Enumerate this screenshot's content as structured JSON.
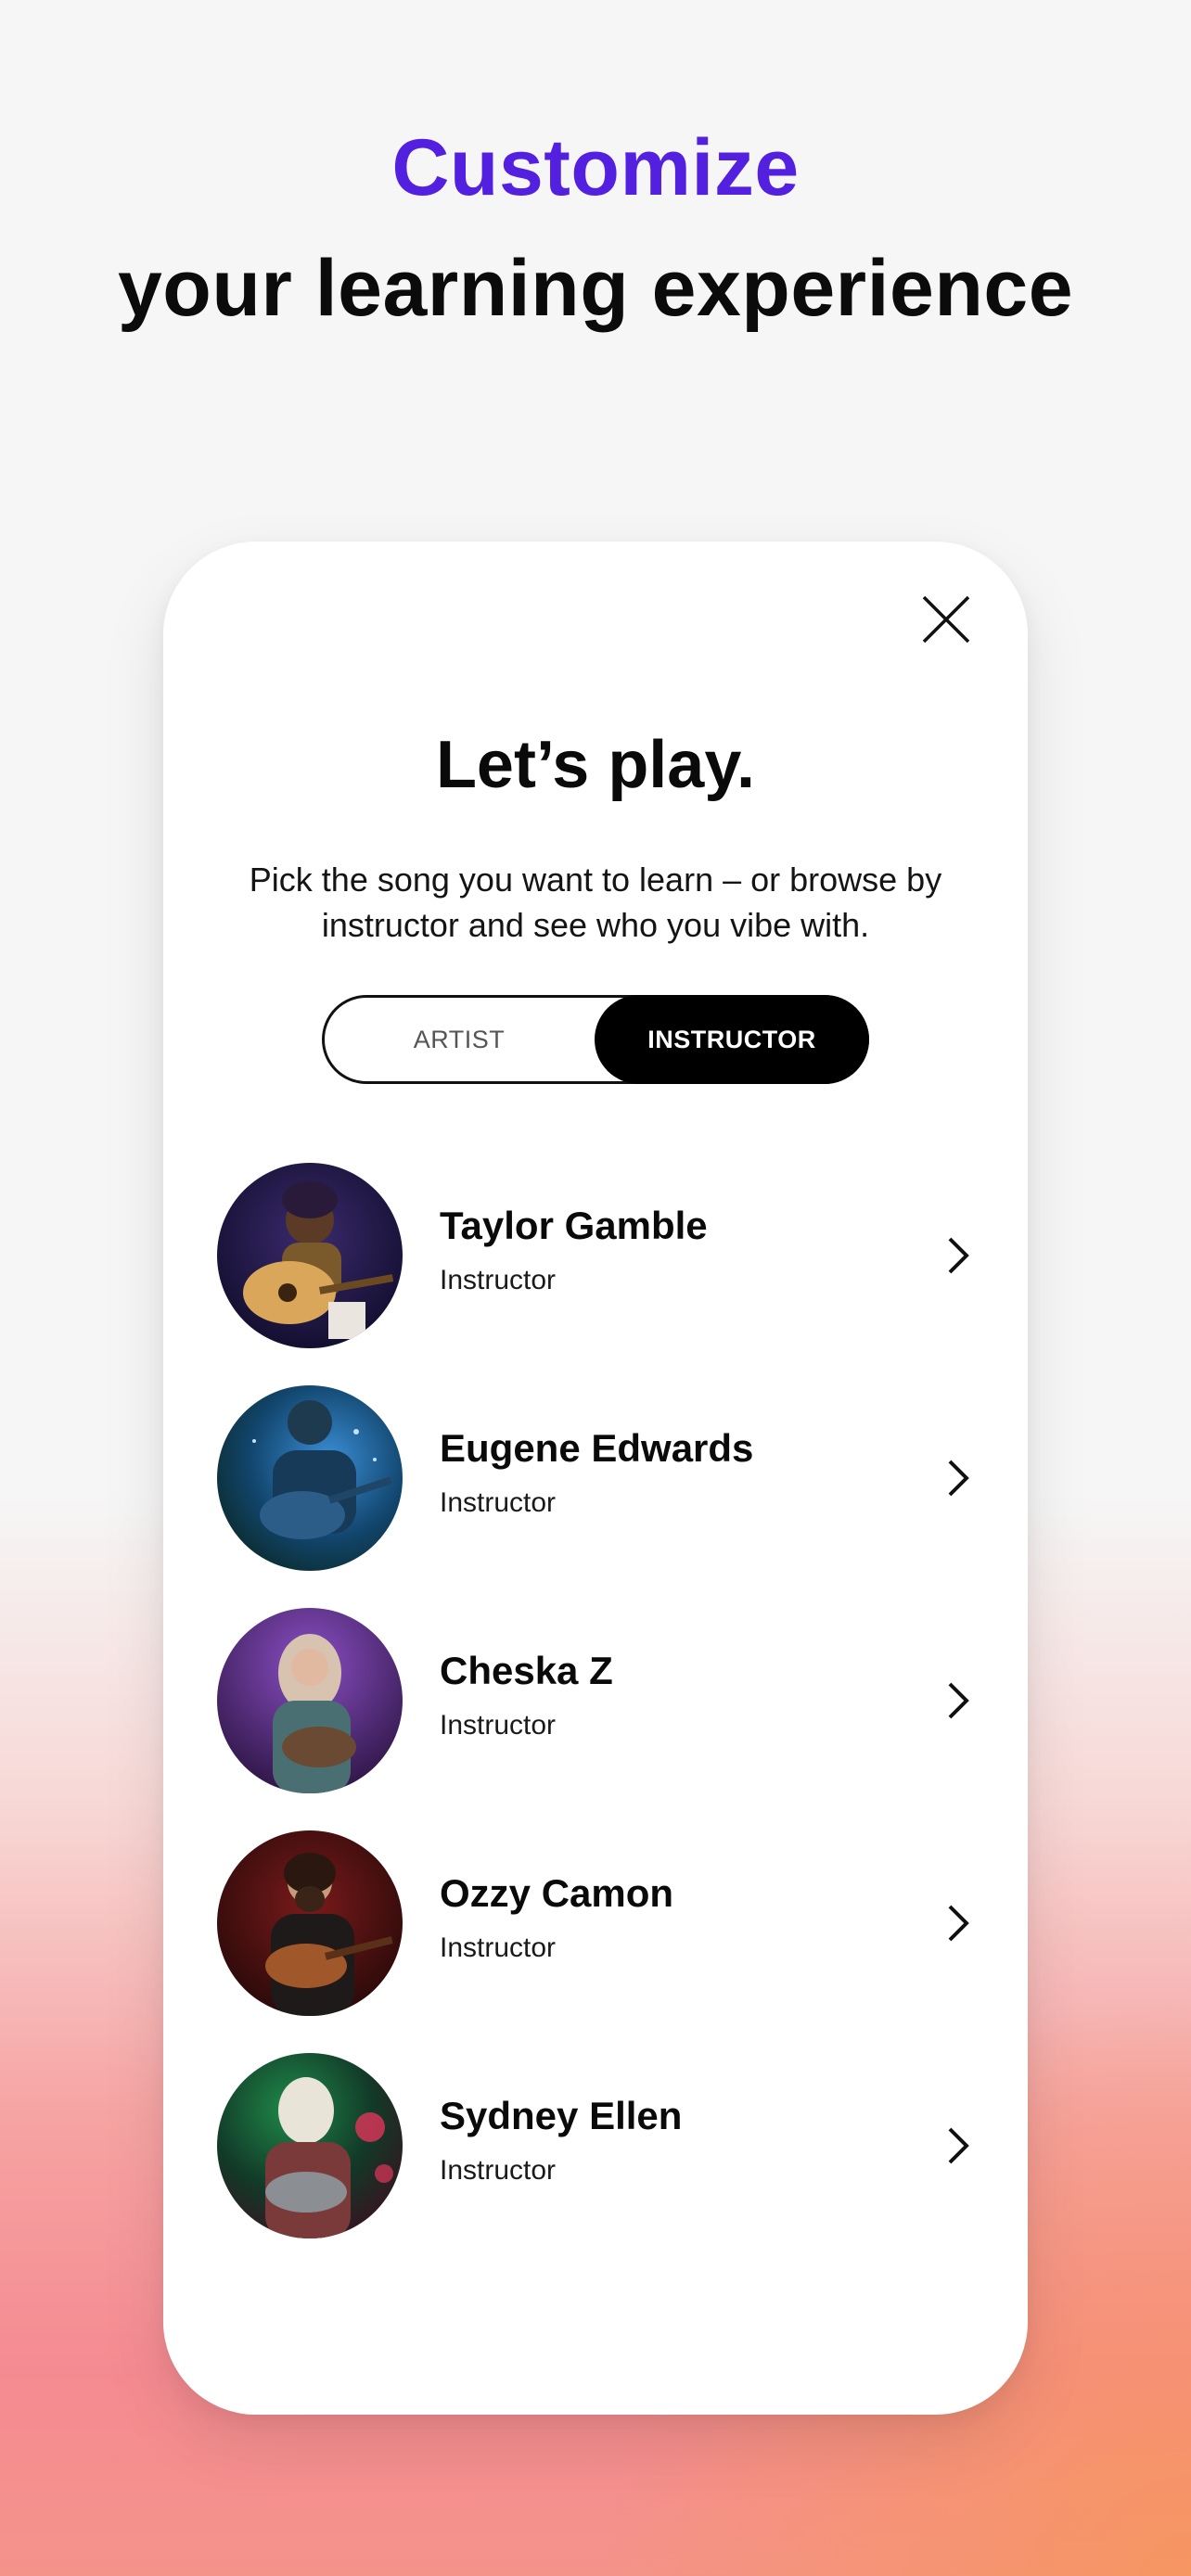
{
  "colors": {
    "accent": "#5320e0",
    "text": "#0a0a0a",
    "toggle_active_bg": "#000000"
  },
  "header": {
    "line1": "Customize",
    "line2": "your learning experience"
  },
  "modal": {
    "close_icon": "close-icon",
    "title": "Let’s play.",
    "subtitle": "Pick the song you want to learn – or browse by instructor and see who you vibe with.",
    "toggle": {
      "options": [
        "ARTIST",
        "INSTRUCTOR"
      ],
      "selected": "INSTRUCTOR"
    },
    "instructors": [
      {
        "name": "Taylor Gamble",
        "role": "Instructor",
        "chevron_icon": "chevron-right-icon"
      },
      {
        "name": "Eugene Edwards",
        "role": "Instructor",
        "chevron_icon": "chevron-right-icon"
      },
      {
        "name": "Cheska Z",
        "role": "Instructor",
        "chevron_icon": "chevron-right-icon"
      },
      {
        "name": "Ozzy Camon",
        "role": "Instructor",
        "chevron_icon": "chevron-right-icon"
      },
      {
        "name": "Sydney Ellen",
        "role": "Instructor",
        "chevron_icon": "chevron-right-icon"
      }
    ]
  }
}
